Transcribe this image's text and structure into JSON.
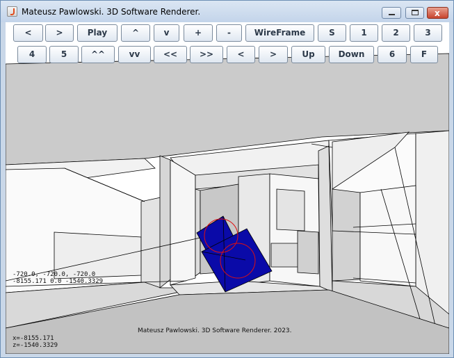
{
  "window": {
    "title": "Mateusz Pawlowski. 3D Software Renderer.",
    "controls": {
      "close_glyph": "x"
    }
  },
  "toolbar": {
    "row1": [
      "<",
      ">",
      "Play",
      "^",
      "v",
      "+",
      "-",
      "WireFrame",
      "S",
      "1",
      "2",
      "3"
    ],
    "row2": [
      "4",
      "5",
      "^^",
      "vv",
      "<<",
      ">>",
      "<",
      ">",
      "Up",
      "Down",
      "6",
      "F"
    ]
  },
  "overlay": {
    "coords_line1": "-720.0, -720.0, -720.0",
    "coords_line2": "-8155.171 0.0 -1540.3329",
    "footer": "Mateusz Pawlowski. 3D Software Renderer. 2023.",
    "pos_x": "x=-8155.171",
    "pos_z": "z=-1540.3329"
  },
  "colors": {
    "object_fill": "#0a0aa8",
    "object_circles": "#e01010",
    "floor": "#c4c4c4",
    "ceiling": "#cccccc",
    "wall": "#f4f4f4"
  }
}
